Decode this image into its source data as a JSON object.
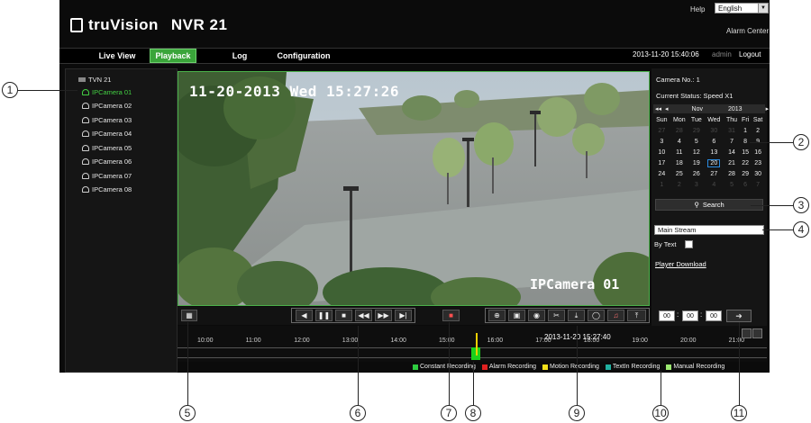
{
  "header": {
    "brand": "truVision",
    "product": "NVR 21",
    "help": "Help",
    "language": "English",
    "alarm_center": "Alarm Center"
  },
  "nav": {
    "tabs": [
      "Live View",
      "Playback",
      "Log",
      "Configuration"
    ],
    "active": "Playback",
    "datetime": "2013-11-20 15:40:06",
    "user": "admin",
    "logout": "Logout"
  },
  "tree": {
    "root": "TVN 21",
    "cameras": [
      "IPCamera 01",
      "IPCamera 02",
      "IPCamera 03",
      "IPCamera 04",
      "IPCamera 05",
      "IPCamera 06",
      "IPCamera 07",
      "IPCamera 08"
    ],
    "selected": "IPCamera 01"
  },
  "video": {
    "timestamp": "11-20-2013 Wed 15:27:26",
    "camera_label": "IPCamera 01"
  },
  "panel": {
    "camera_no": "Camera No.: 1",
    "status": "Current Status:  Speed X1",
    "month": "Nov",
    "year": "2013",
    "weekdays": [
      "Sun",
      "Mon",
      "Tue",
      "Wed",
      "Thu",
      "Fri",
      "Sat"
    ],
    "weeks": [
      [
        "27",
        "28",
        "29",
        "30",
        "31",
        "1",
        "2"
      ],
      [
        "3",
        "4",
        "5",
        "6",
        "7",
        "8",
        "9"
      ],
      [
        "10",
        "11",
        "12",
        "13",
        "14",
        "15",
        "16"
      ],
      [
        "17",
        "18",
        "19",
        "20",
        "21",
        "22",
        "23"
      ],
      [
        "24",
        "25",
        "26",
        "27",
        "28",
        "29",
        "30"
      ],
      [
        "1",
        "2",
        "3",
        "4",
        "5",
        "6",
        "7"
      ]
    ],
    "selected_day": "20",
    "search": "Search",
    "stream": "Main Stream",
    "by_text": "By Text",
    "player_download": "Player Download"
  },
  "search_time": {
    "hh": "00",
    "mm": "00",
    "ss": "00"
  },
  "timeline": {
    "current": "2013-11-20 15:27:40",
    "hours": [
      "10:00",
      "11:00",
      "12:00",
      "13:00",
      "14:00",
      "15:00",
      "16:00",
      "17:00",
      "18:00",
      "19:00",
      "20:00",
      "21:00"
    ]
  },
  "legend": [
    {
      "label": "Constant Recording",
      "color": "#2ecc40"
    },
    {
      "label": "Alarm Recording",
      "color": "#e02020"
    },
    {
      "label": "Motion Recording",
      "color": "#f2e01a"
    },
    {
      "label": "TextIn Recording",
      "color": "#20b0a0"
    },
    {
      "label": "Manual Recording",
      "color": "#9be870"
    }
  ],
  "callouts": [
    "1",
    "2",
    "3",
    "4",
    "5",
    "6",
    "7",
    "8",
    "9",
    "10",
    "11"
  ]
}
